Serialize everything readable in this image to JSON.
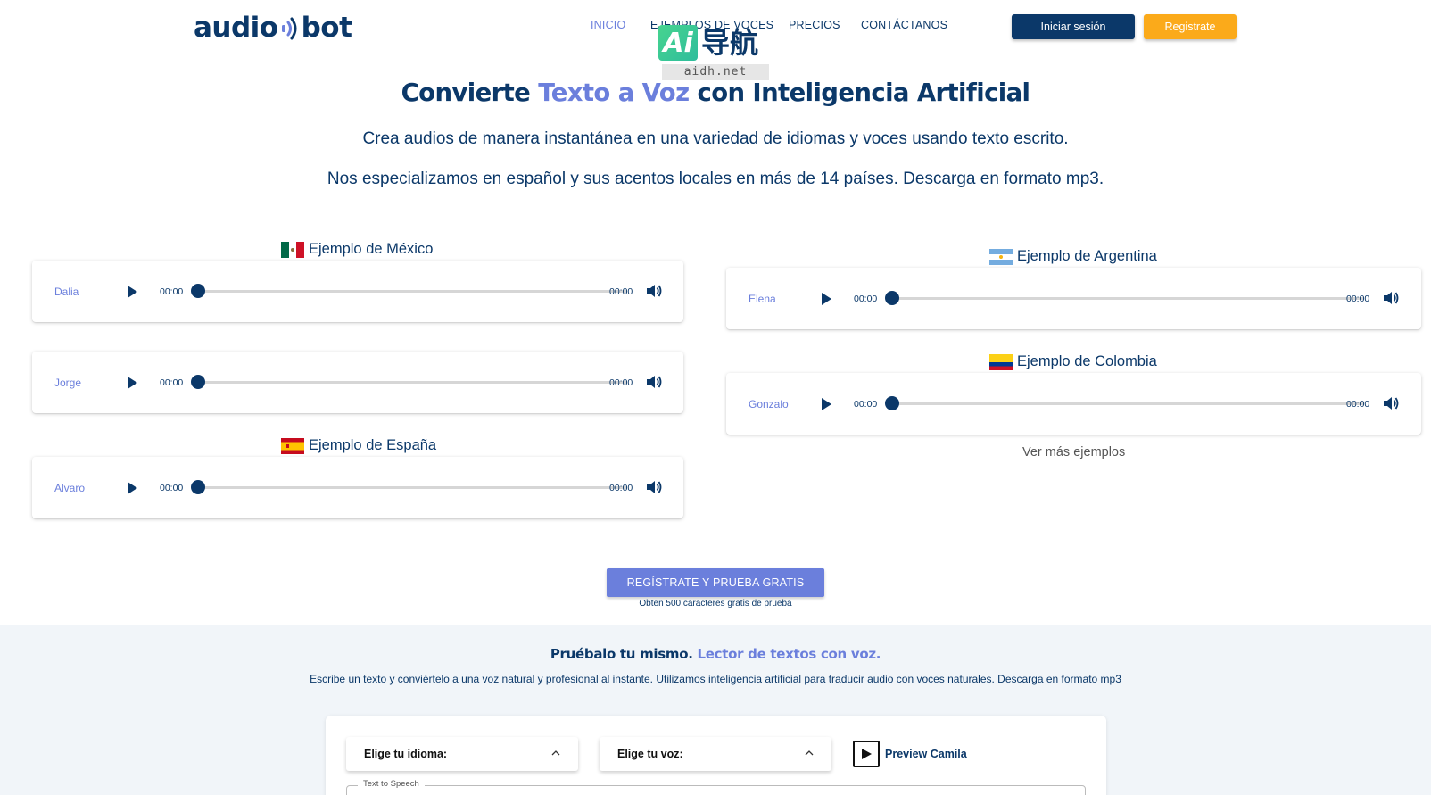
{
  "header": {
    "logo_left": "audio",
    "logo_right": "bot",
    "nav": [
      {
        "label": "INICIO",
        "active": true
      },
      {
        "label": "EJEMPLOS DE VOCES",
        "active": false
      },
      {
        "label": "PRECIOS",
        "active": false
      },
      {
        "label": "CONTÁCTANOS",
        "active": false
      }
    ],
    "login_label": "Iniciar sesión",
    "register_label": "Registrate"
  },
  "watermark": {
    "ai": "Ai",
    "cn": "导航",
    "url": "aidh.net"
  },
  "hero": {
    "title_part1": "Convierte ",
    "title_accent": "Texto a Voz",
    "title_part2": " con Inteligencia Artificial",
    "sub1": "Crea audios de manera instantánea en una variedad de idiomas y voces usando texto escrito.",
    "sub2": "Nos especializamos en español y sus acentos locales en más de 14 países. Descarga en formato mp3."
  },
  "examples": {
    "mexico": {
      "heading": "Ejemplo de México",
      "players": [
        {
          "name": "Dalia",
          "current": "00:00",
          "duration": "00:00"
        },
        {
          "name": "Jorge",
          "current": "00:00",
          "duration": "00:00"
        }
      ]
    },
    "espana": {
      "heading": "Ejemplo de España",
      "players": [
        {
          "name": "Alvaro",
          "current": "00:00",
          "duration": "00:00"
        }
      ]
    },
    "argentina": {
      "heading": "Ejemplo de Argentina",
      "players": [
        {
          "name": "Elena",
          "current": "00:00",
          "duration": "00:00"
        }
      ]
    },
    "colombia": {
      "heading": "Ejemplo de Colombia",
      "players": [
        {
          "name": "Gonzalo",
          "current": "00:00",
          "duration": "00:00"
        }
      ]
    },
    "more_label": "Ver más ejemplos"
  },
  "cta": {
    "button_label": "REGÍSTRATE Y PRUEBA GRATIS",
    "note": "Obten 500 caracteres gratis de prueba"
  },
  "try": {
    "title_part1": "Pruébalo tu mismo. ",
    "title_accent": "Lector de textos con voz.",
    "description": "Escribe un texto y conviértelo a una voz natural y profesional al instante. Utilizamos inteligencia artificial para traducir audio con voces naturales. Descarga en formato mp3",
    "language_label": "Elige tu idioma:",
    "voice_label": "Elige tu voz:",
    "preview_label": "Preview Camila",
    "tts_label": "Text to Speech"
  },
  "colors": {
    "navy": "#0b3869",
    "accent": "#6b7fdc",
    "orange": "#fbaa1a"
  }
}
